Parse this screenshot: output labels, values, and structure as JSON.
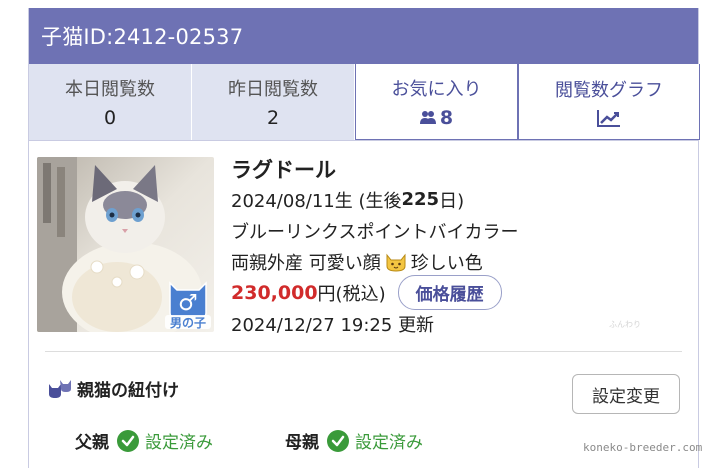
{
  "header": {
    "title": "子猫ID:2412-02537"
  },
  "stats": {
    "today_label": "本日閲覧数",
    "today_value": "0",
    "yesterday_label": "昨日閲覧数",
    "yesterday_value": "2",
    "favorites_label": "お気に入り",
    "favorites_value": "8",
    "graph_label": "閲覧数グラフ"
  },
  "kitten": {
    "breed": "ラグドール",
    "birth_date": "2024/08/11生 (生後 ",
    "age_days": "225",
    "age_suffix": " 日)",
    "color": "ブルーリンクスポイントバイカラー",
    "features_a": "両親外産 可愛い顔",
    "features_b": "珍しい色",
    "price": "230,000",
    "price_unit": "円(税込)",
    "price_history_label": "価格履歴",
    "updated": "2024/12/27 19:25 更新",
    "gender_label": "男の子",
    "gender_symbol": "♂",
    "photo_watermark": "ふんわり"
  },
  "parents": {
    "section_title": "親猫の紐付け",
    "settings_button": "設定変更",
    "father_label": "父親",
    "father_status": "設定済み",
    "mother_label": "母親",
    "mother_status": "設定済み"
  },
  "footer": {
    "site_watermark": "koneko-breeder.com"
  },
  "colors": {
    "header_bg": "#6e72b4",
    "accent": "#4a4f9a",
    "price": "#d12b2b",
    "status_ok": "#3a9a3a"
  }
}
